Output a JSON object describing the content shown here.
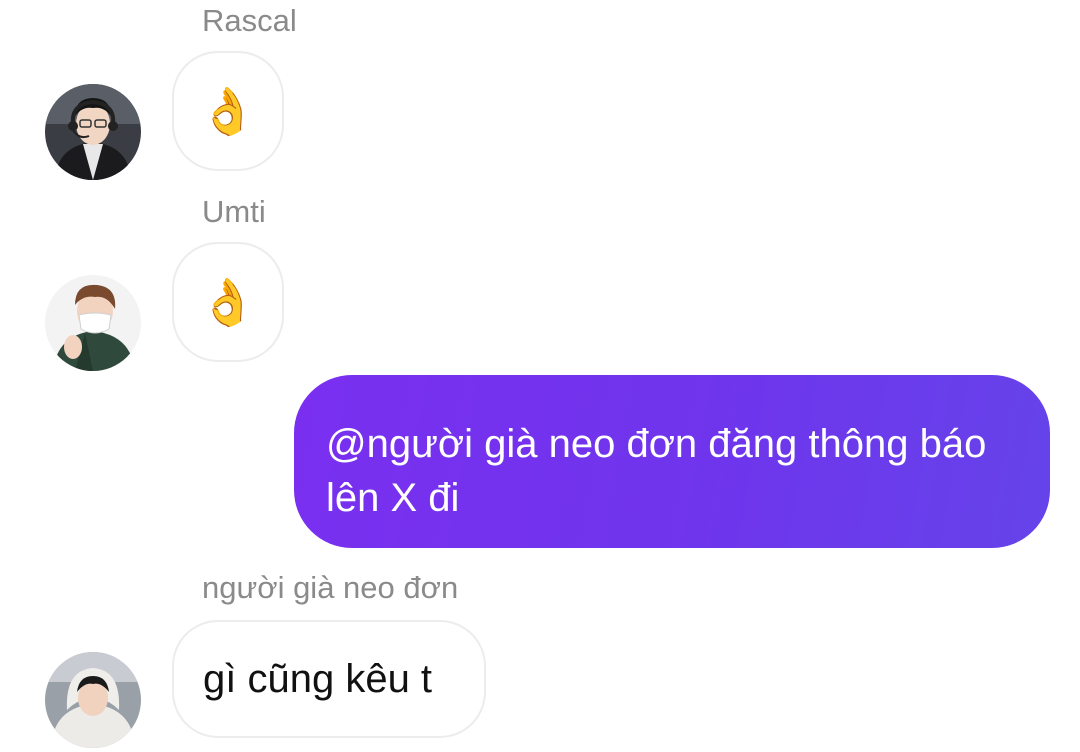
{
  "messages": [
    {
      "sender": "Rascal",
      "content": "👌",
      "avatar": "avatar-rascal"
    },
    {
      "sender": "Umti",
      "content": "👌",
      "avatar": "avatar-umti"
    },
    {
      "sender": "",
      "content": "@người già neo đơn đăng thông báo lên X đi",
      "outgoing": true
    },
    {
      "sender": "người già neo đơn",
      "content": "gì cũng kêu t",
      "avatar": "avatar-nguoi-gia-neo-don"
    }
  ],
  "colors": {
    "outgoing_bubble": "#7234ee",
    "incoming_border": "#ececec",
    "sender_name": "#8a8a8a"
  }
}
